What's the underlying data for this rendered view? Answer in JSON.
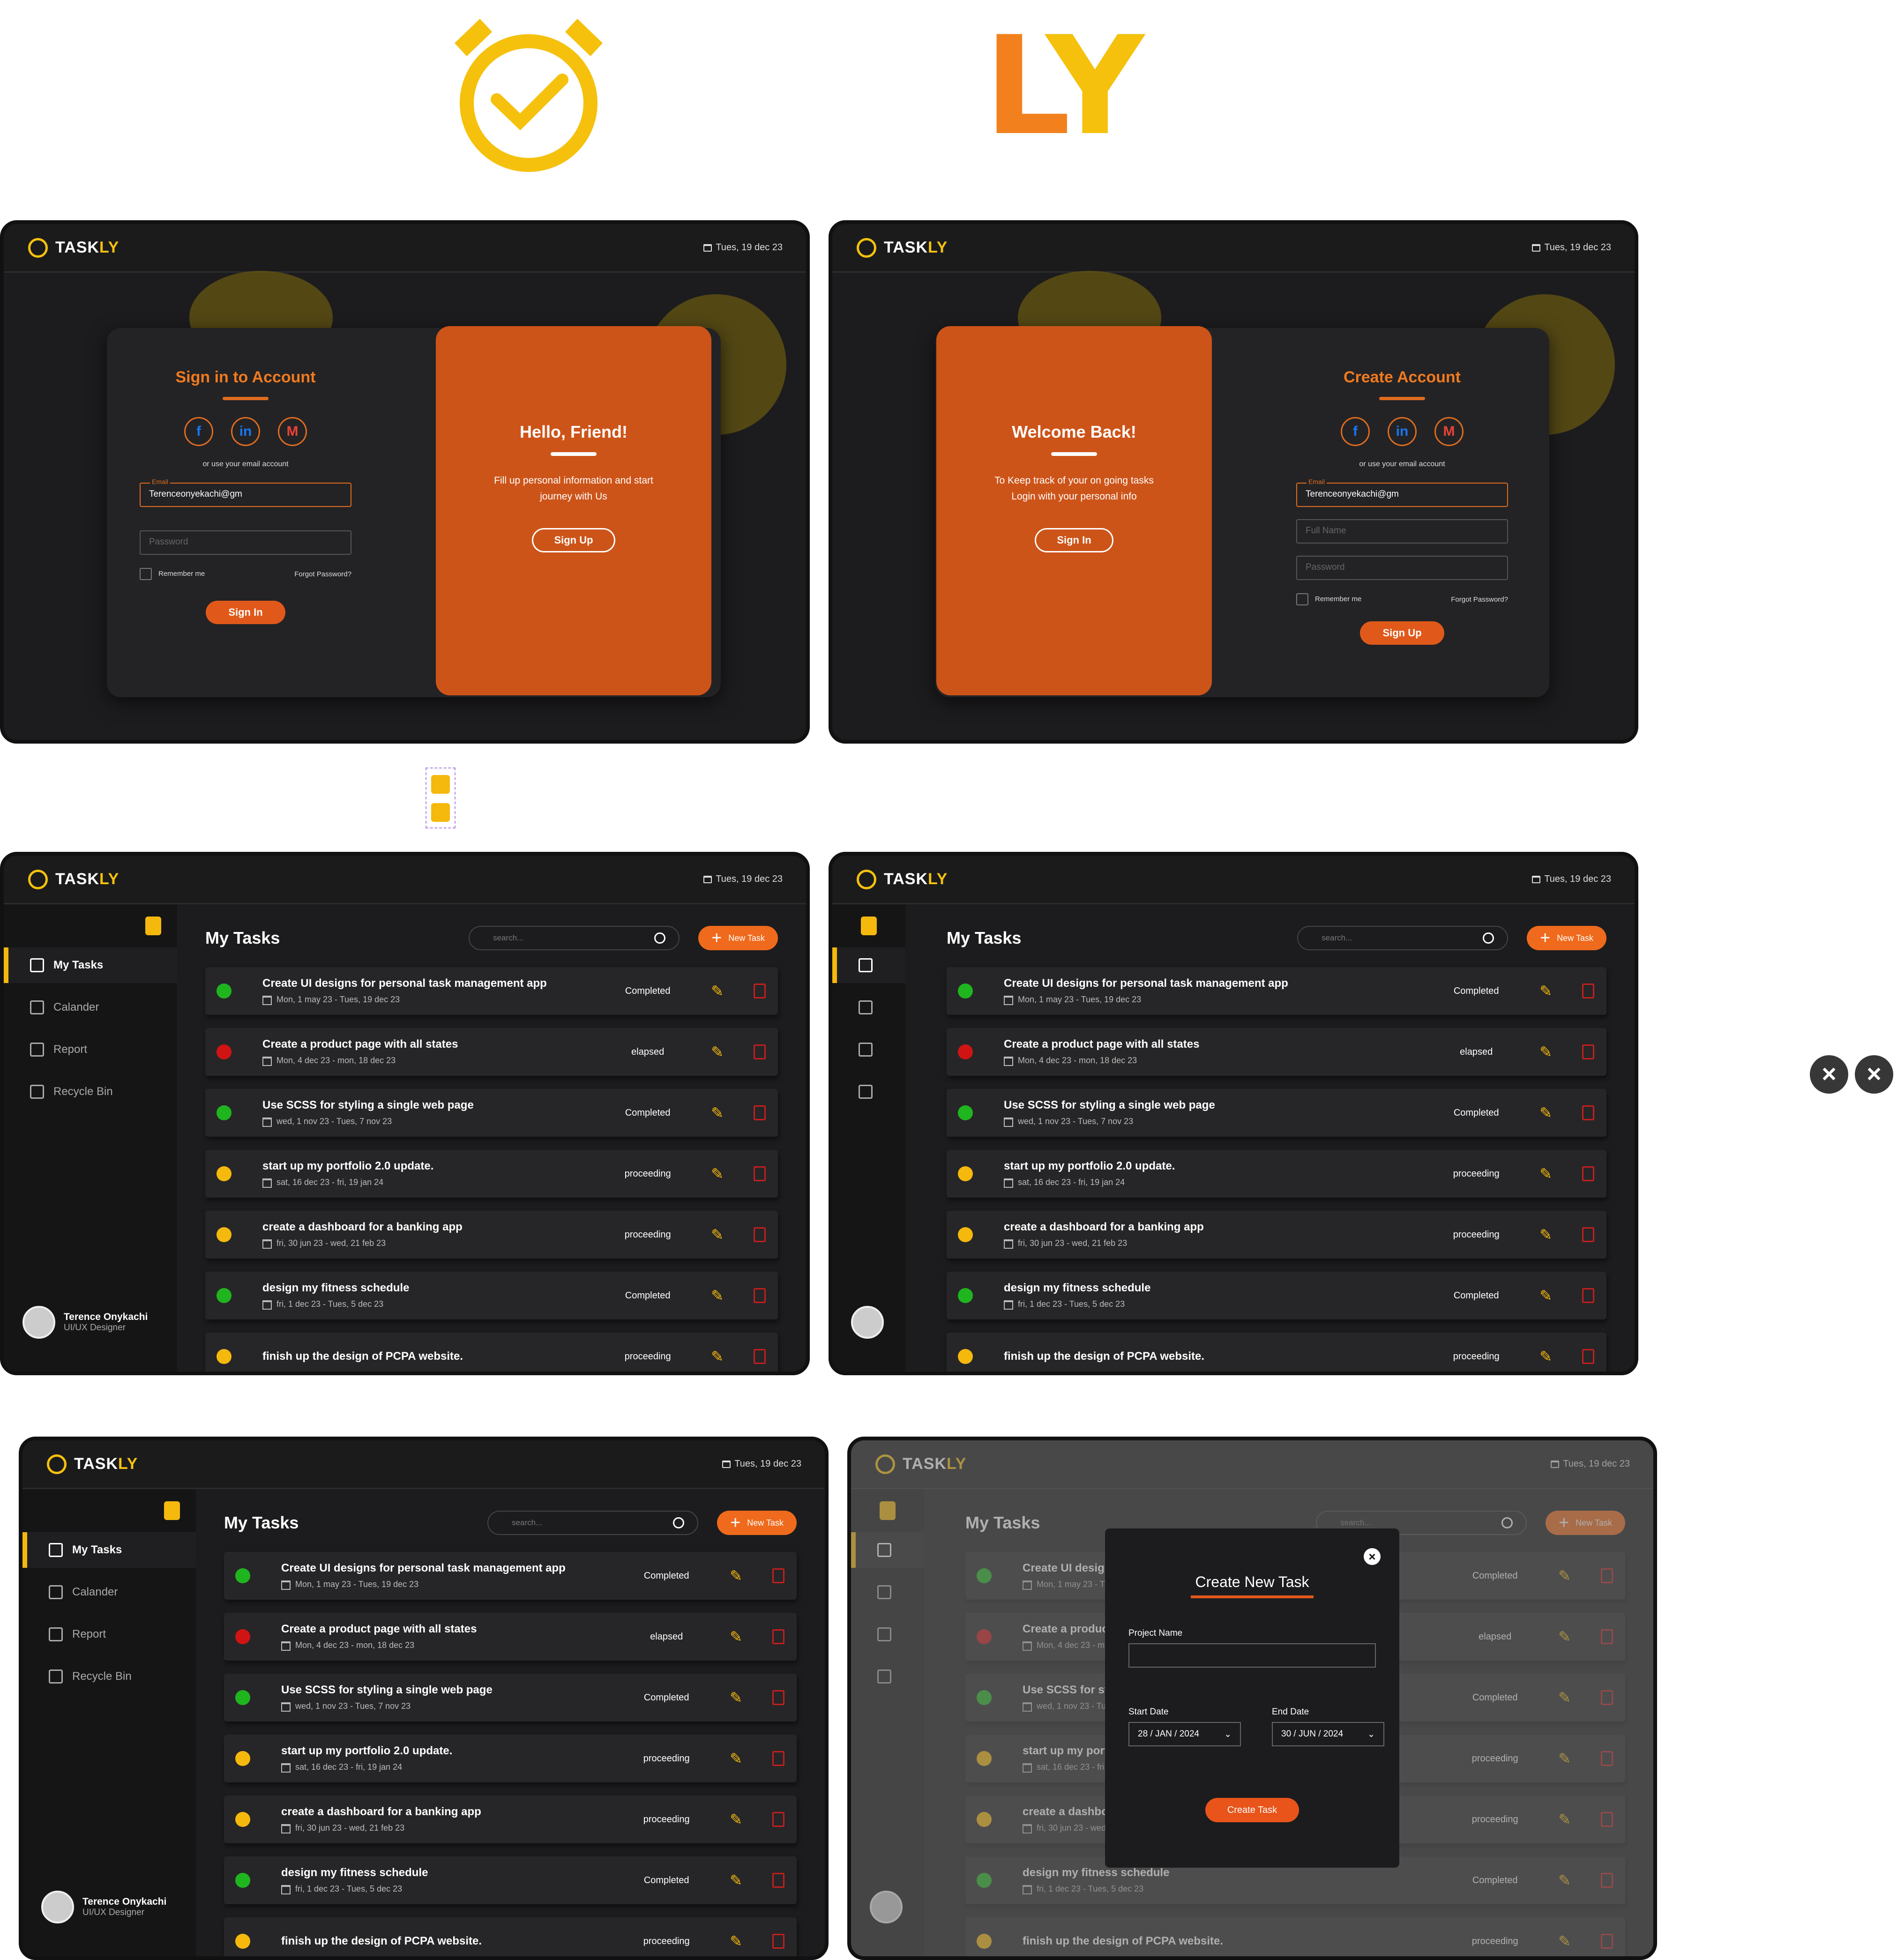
{
  "brand": {
    "word": "TASK",
    "ly": "LY",
    "big_ly_l": "L",
    "big_ly_y": "Y"
  },
  "date": "Tues, 19 dec 23",
  "signin": {
    "title": "Sign in to Account",
    "or": "or use your email account",
    "email_label": "Email",
    "email_value": "Terenceonyekachi@gm",
    "password": "Password",
    "remember": "Remember me",
    "forgot": "Forgot Password?",
    "button": "Sign In",
    "panel_title": "Hello, Friend!",
    "panel_text": "Fill up personal information and start journey with Us",
    "panel_button": "Sign Up"
  },
  "signup": {
    "title": "Create Account",
    "or": "or use your email account",
    "email_label": "Email",
    "email_value": "Terenceonyekachi@gm",
    "fullname": "Full Name",
    "password": "Password",
    "remember": "Remember me",
    "forgot": "Forgot Password?",
    "button": "Sign Up",
    "panel_title": "Welcome Back!",
    "panel_text": "To Keep track of your on going tasks Login with your personal info",
    "panel_button": "Sign In"
  },
  "sidebar": {
    "items": [
      "My Tasks",
      "Calander",
      "Report",
      "Recycle Bin"
    ],
    "user_name": "Terence Onykachi",
    "user_role": "UI/UX Designer"
  },
  "main": {
    "title": "My Tasks",
    "search": "search...",
    "new_task": "New Task"
  },
  "tasks": [
    {
      "title": "Create UI designs for  personal  task management  app",
      "dates": "Mon, 1 may 23  - Tues, 19 dec 23",
      "status": "Completed",
      "color": "#1fb51f"
    },
    {
      "title": "Create a product page with all states",
      "dates": "Mon, 4 dec 23  - mon, 18 dec 23",
      "status": "elapsed",
      "color": "#d01414"
    },
    {
      "title": "Use SCSS for styling a single web page",
      "dates": "wed, 1 nov 23  - Tues, 7 nov 23",
      "status": "Completed",
      "color": "#1fb51f"
    },
    {
      "title": "start up my portfolio 2.0 update.",
      "dates": "sat, 16 dec 23  - fri, 19 jan 24",
      "status": "proceeding",
      "color": "#f5b80d"
    },
    {
      "title": "create a dashboard for a banking app",
      "dates": "fri, 30 jun 23  - wed, 21 feb 23",
      "status": "proceeding",
      "color": "#f5b80d"
    },
    {
      "title": "design my fitness schedule",
      "dates": "fri, 1 dec 23  - Tues, 5 dec 23",
      "status": "Completed",
      "color": "#1fb51f"
    },
    {
      "title": "finish up the design of PCPA website.",
      "dates": "",
      "status": "proceeding",
      "color": "#f5b80d"
    }
  ],
  "modal": {
    "title": "Create New Task",
    "project": "Project Name",
    "start_label": "Start Date",
    "start": "28 / JAN / 2024",
    "end_label": "End Date",
    "end": "30 / JUN / 2024",
    "button": "Create Task"
  }
}
